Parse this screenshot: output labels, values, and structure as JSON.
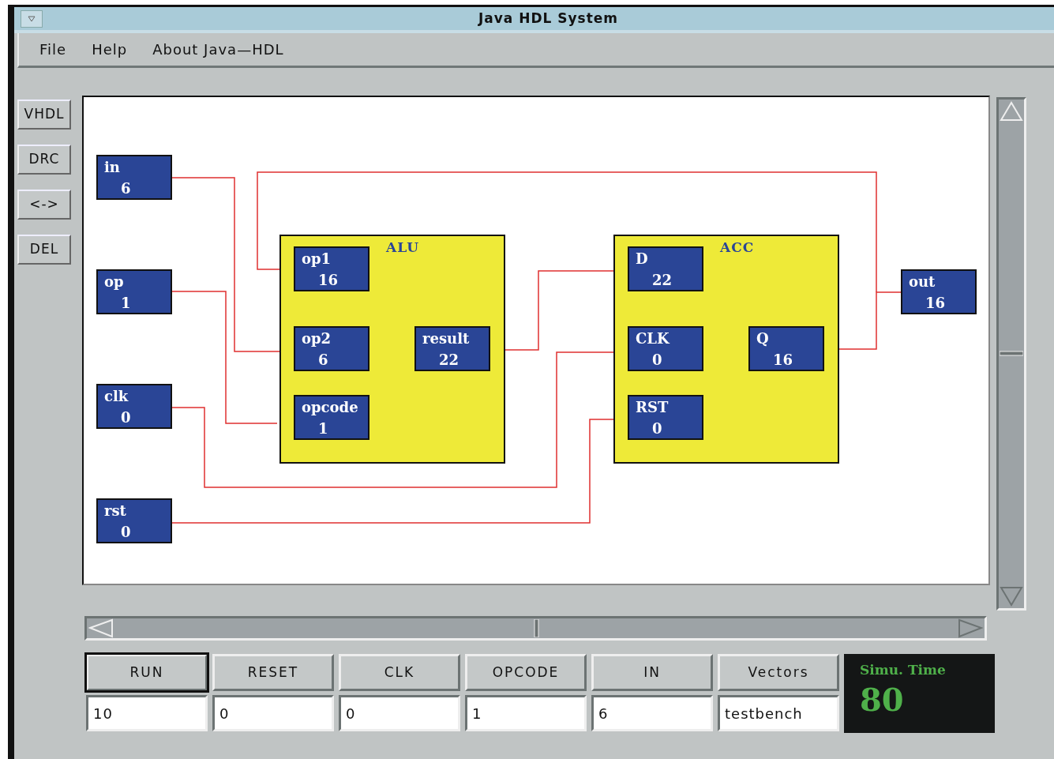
{
  "window": {
    "title": "Java HDL System"
  },
  "menu": [
    "File",
    "Help",
    "About Java—HDL"
  ],
  "tools": [
    "VHDL",
    "DRC",
    "<->",
    "DEL"
  ],
  "diagram": {
    "inputs": [
      {
        "label": "in",
        "value": "6"
      },
      {
        "label": "op",
        "value": "1"
      },
      {
        "label": "clk",
        "value": "0"
      },
      {
        "label": "rst",
        "value": "0"
      }
    ],
    "blocks": [
      {
        "title": "ALU",
        "ports": [
          {
            "label": "op1",
            "value": "16"
          },
          {
            "label": "op2",
            "value": "6"
          },
          {
            "label": "opcode",
            "value": "1"
          },
          {
            "label": "result",
            "value": "22"
          }
        ]
      },
      {
        "title": "ACC",
        "ports": [
          {
            "label": "D",
            "value": "22"
          },
          {
            "label": "CLK",
            "value": "0"
          },
          {
            "label": "RST",
            "value": "0"
          },
          {
            "label": "Q",
            "value": "16"
          }
        ]
      }
    ],
    "outputs": [
      {
        "label": "out",
        "value": "16"
      }
    ]
  },
  "controls": [
    {
      "label": "RUN",
      "default": true,
      "value": "10"
    },
    {
      "label": "RESET",
      "default": false,
      "value": "0"
    },
    {
      "label": "CLK",
      "default": false,
      "value": "0"
    },
    {
      "label": "OPCODE",
      "default": false,
      "value": "1"
    },
    {
      "label": "IN",
      "default": false,
      "value": "6"
    },
    {
      "label": "Vectors",
      "default": false,
      "value": "testbench"
    }
  ],
  "sim_time": {
    "label": "Simu. Time",
    "value": "80"
  }
}
